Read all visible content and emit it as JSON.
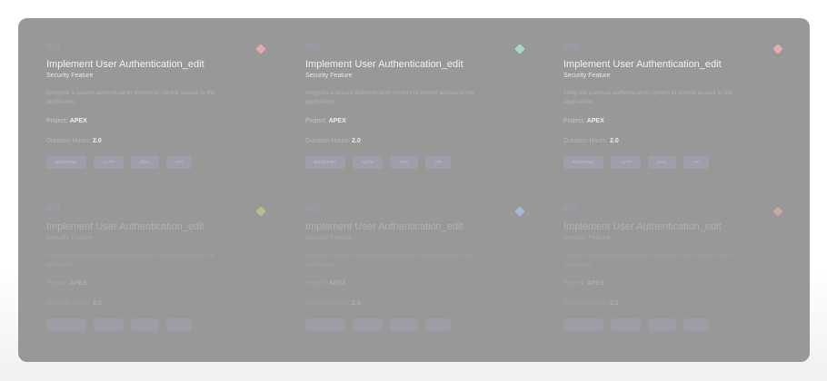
{
  "cards": [
    {
      "number": "#01",
      "title": "Implement User Authentication_edit",
      "subtitle": "Security Feature",
      "description": "Integrate a secure authentication system to control access to the application.",
      "project_label": "Project:",
      "project_value": "APEX",
      "duration_label": "Duration Hours:",
      "duration_value": "2.0",
      "tags": [
        "BACKEND",
        "AUTH",
        "MVC",
        "API"
      ],
      "diamond_color": "#e4a9ad"
    },
    {
      "number": "#01",
      "title": "Implement User Authentication_edit",
      "subtitle": "Security Feature",
      "description": "Integrate a secure authentication system to control access to the application.",
      "project_label": "Project:",
      "project_value": "APEX",
      "duration_label": "Duration Hours:",
      "duration_value": "2.0",
      "tags": [
        "BACKEND",
        "AUTH",
        "MVC",
        "API"
      ],
      "diamond_color": "#a9d9c8"
    },
    {
      "number": "#01",
      "title": "Implement User Authentication_edit",
      "subtitle": "Security Feature",
      "description": "Integrate a secure authentication system to control access to the application.",
      "project_label": "Project:",
      "project_value": "APEX",
      "duration_label": "Duration Hours:",
      "duration_value": "2.0",
      "tags": [
        "BACKEND",
        "AUTH",
        "MVC",
        "API"
      ],
      "diamond_color": "#e6acb2"
    },
    {
      "number": "#01",
      "title": "Implement User Authentication_edit",
      "subtitle": "Security Feature",
      "description": "Integrate a secure authentication system to control access to the application.",
      "project_label": "Project:",
      "project_value": "APEX",
      "duration_label": "Duration Hours:",
      "duration_value": "2.0",
      "tags": [
        "BACKEND",
        "AUTH",
        "MVC",
        "API"
      ],
      "diamond_color": "#b7bd8f"
    },
    {
      "number": "#01",
      "title": "Implement User Authentication_edit",
      "subtitle": "Security Feature",
      "description": "Integrate a secure authentication system to control access to the application.",
      "project_label": "Project:",
      "project_value": "APEX",
      "duration_label": "Duration Hours:",
      "duration_value": "2.0",
      "tags": [
        "BACKEND",
        "AUTH",
        "MVC",
        "API"
      ],
      "diamond_color": "#a4b8d6"
    },
    {
      "number": "#01",
      "title": "Implement User Authentication_edit",
      "subtitle": "Security Feature",
      "description": "Integrate a secure authentication system to control access to the application.",
      "project_label": "Project:",
      "project_value": "APEX",
      "duration_label": "Duration Hours:",
      "duration_value": "2.0",
      "tags": [
        "BACKEND",
        "AUTH",
        "MVC",
        "API"
      ],
      "diamond_color": "#c9a7a3"
    }
  ]
}
